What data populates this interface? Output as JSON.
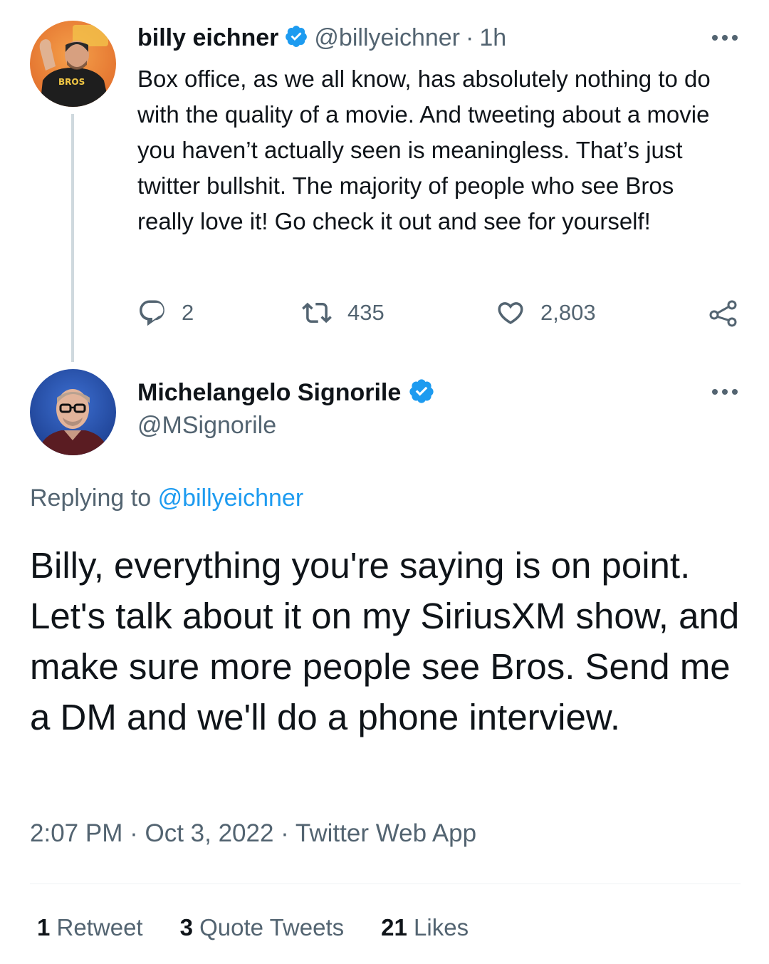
{
  "tweet1": {
    "author_name": "billy eichner",
    "handle": "@billyeichner",
    "separator": "·",
    "time": "1h",
    "avatar_shirt_text": "BROS",
    "text": "Box office, as we all know, has absolutely nothing to do with the quality of a movie. And tweeting about a movie you haven’t actually seen is meaningless. That’s just twitter bullshit. The majority of people who see Bros really love it! Go check it out and see for yourself!",
    "reply_count": "2",
    "retweet_count": "435",
    "like_count": "2,803",
    "icons": [
      "reply-icon",
      "retweet-icon",
      "like-icon",
      "share-icon",
      "more-icon",
      "verified-badge-icon"
    ]
  },
  "tweet2": {
    "author_name": "Michelangelo Signorile",
    "handle": "@MSignorile",
    "replying_prefix": "Replying to",
    "replying_to": "@billyeichner",
    "text": "Billy, everything you're saying is on point. Let's talk about it on my SiriusXM show, and make sure more people see Bros. Send me a DM and we'll do a phone interview.",
    "time": "2:07 PM",
    "separator": "·",
    "date": "Oct 3, 2022",
    "source": "Twitter Web App",
    "stats": {
      "retweets_count": "1",
      "retweets_label": "Retweet",
      "quotes_count": "3",
      "quotes_label": "Quote Tweets",
      "likes_count": "21",
      "likes_label": "Likes"
    }
  },
  "colors": {
    "text": "#0f1419",
    "secondary": "#536471",
    "accent": "#1d9bf0",
    "thread_line": "#cfd9de"
  }
}
